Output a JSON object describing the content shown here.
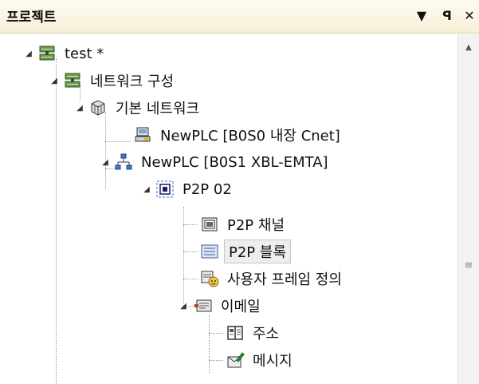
{
  "panel": {
    "title": "프로젝트",
    "dropdown_icon": "▼",
    "pin_icon": "ꟼ",
    "close_icon": "✕"
  },
  "tree": {
    "root": {
      "label": "test *",
      "icon": "network-icon"
    },
    "network_config": {
      "label": "네트워크 구성",
      "icon": "network-icon"
    },
    "basic_network": {
      "label": "기본 네트워크",
      "icon": "cube-icon"
    },
    "plc_cnet": {
      "label": "NewPLC [B0S0 내장 Cnet]",
      "icon": "serial-device-icon"
    },
    "plc_xbl": {
      "label": "NewPLC [B0S1 XBL-EMTA]",
      "icon": "ethernet-device-icon"
    },
    "p2p": {
      "label": "P2P 02",
      "icon": "p2p-icon"
    },
    "p2p_channel": {
      "label": "P2P 채널",
      "icon": "channel-icon"
    },
    "p2p_block": {
      "label": "P2P 블록",
      "icon": "block-list-icon"
    },
    "user_frame": {
      "label": "사용자 프레임 정의",
      "icon": "user-frame-icon"
    },
    "email": {
      "label": "이메일",
      "icon": "email-icon"
    },
    "address": {
      "label": "주소",
      "icon": "address-book-icon"
    },
    "message": {
      "label": "메시지",
      "icon": "message-icon"
    }
  },
  "selected_item": "P2P 블록"
}
